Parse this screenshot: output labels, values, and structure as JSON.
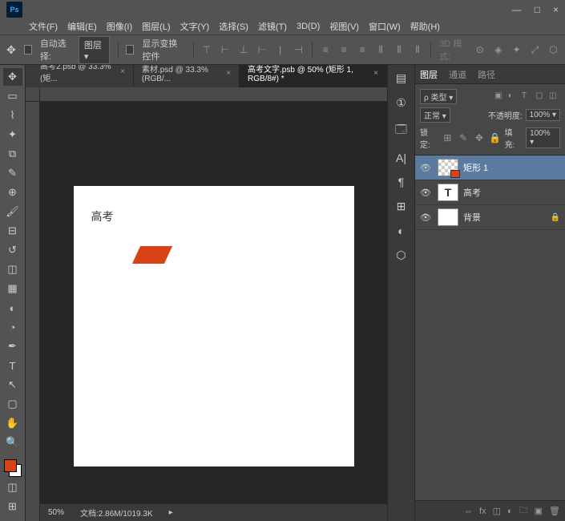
{
  "window_controls": {
    "min": "—",
    "max": "□",
    "close": "×"
  },
  "menu": [
    "文件(F)",
    "编辑(E)",
    "图像(I)",
    "图层(L)",
    "文字(Y)",
    "选择(S)",
    "滤镜(T)",
    "3D(D)",
    "视图(V)",
    "窗口(W)",
    "帮助(H)"
  ],
  "options": {
    "auto_select": "自动选择:",
    "layer_dropdown": "图层",
    "show_transform": "显示变换控件",
    "mode_3d": "3D 模式:"
  },
  "tabs": [
    {
      "label": "高考2.psb @ 33.3% (矩...",
      "active": false
    },
    {
      "label": "素材.psd @ 33.3%(RGB/...",
      "active": false
    },
    {
      "label": "高考文字.psb @ 50% (矩形 1, RGB/8#) *",
      "active": true
    }
  ],
  "canvas": {
    "text": "高考"
  },
  "status": {
    "zoom": "50%",
    "doc_info": "文档:2.86M/1019.3K"
  },
  "layers_panel": {
    "tabs": [
      "图层",
      "通道",
      "路径"
    ],
    "filter": "ρ 类型",
    "blend_mode": "正常",
    "opacity_label": "不透明度:",
    "opacity": "100%",
    "lock_label": "锁定:",
    "fill_label": "填充:",
    "fill": "100%",
    "layers": [
      {
        "name": "矩形 1",
        "type": "shape",
        "visible": true,
        "selected": true
      },
      {
        "name": "高考",
        "type": "text",
        "visible": true,
        "selected": false
      },
      {
        "name": "背景",
        "type": "bg",
        "visible": true,
        "selected": false,
        "locked": true
      }
    ]
  }
}
